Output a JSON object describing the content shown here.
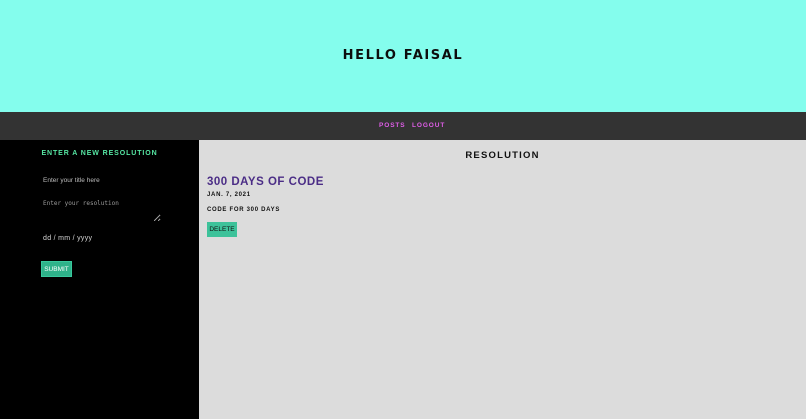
{
  "colors": {
    "hero_bg": "#84fded",
    "navbar_bg": "#333333",
    "nav_link": "#e05ee9",
    "sidebar_bg": "#000000",
    "sidebar_heading": "#56e6a3",
    "main_bg": "#dcdcdc",
    "post_title": "#4b2d86",
    "button_bg": "#2fb28a"
  },
  "hero": {
    "title": "HELLO FAISAL"
  },
  "nav": {
    "posts_label": "POSTS",
    "logout_label": "LOGOUT"
  },
  "form": {
    "heading": "ENTER A NEW RESOLUTION",
    "title_placeholder": "Enter your title here",
    "resolution_placeholder": "Enter your resolution",
    "date_placeholder": "dd / mm / yyyy",
    "submit_label": "SUBMIT"
  },
  "main": {
    "heading": "RESOLUTION",
    "posts": [
      {
        "title": "300 DAYS OF CODE",
        "date": "JAN. 7, 2021",
        "body": "CODE FOR 300 DAYS",
        "delete_label": "DELETE"
      }
    ]
  }
}
